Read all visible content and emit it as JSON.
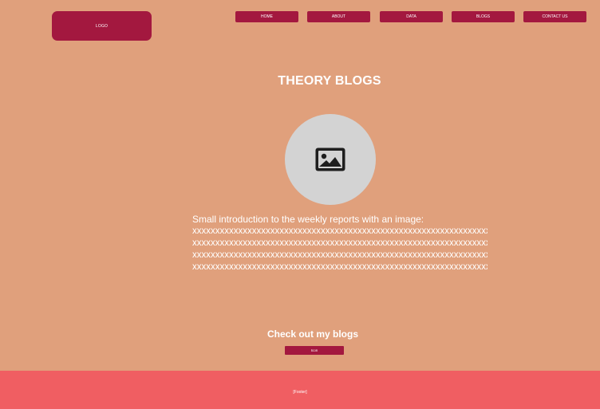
{
  "header": {
    "logo_label": "LOGO",
    "nav": [
      {
        "label": "HOME"
      },
      {
        "label": "ABOUT"
      },
      {
        "label": "DATA"
      },
      {
        "label": "BLOGS"
      },
      {
        "label": "CONTACT US"
      }
    ]
  },
  "main": {
    "title": "THEORY BLOGS",
    "image_icon": "image-placeholder-icon",
    "intro_lead": "Small introduction to the weekly reports with an image:",
    "intro_lines": [
      "xxxxxxxxxxxxxxxxxxxxxxxxxxxxxxxxxxxxxxxxxxxxxxxxxxxxxxxxxxxxxxxxxxxxxxxxxx",
      "xxxxxxxxxxxxxxxxxxxxxxxxxxxxxxxxxxxxxxxxxxxxxxxxxxxxxxxxxxxxxxxxxxxxxxxxxx",
      "xxxxxxxxxxxxxxxxxxxxxxxxxxxxxxxxxxxxxxxxxxxxxxxxxxxxxxxxxxxxxxxxxxxxxxxxxx",
      "xxxxxxxxxxxxxxxxxxxxxxxxxxxxxxxxxxxxxxxxxxxxxxxxxxxxxxxxxxxxxxxxxxxxxxxxxx"
    ]
  },
  "cta": {
    "title": "Check out my blogs",
    "button_label": "Icon"
  },
  "footer": {
    "label": "[Footer]"
  },
  "colors": {
    "background": "#e0a07c",
    "accent": "#a3183f",
    "footer": "#f05e62",
    "image_placeholder": "#d3d3d3"
  }
}
